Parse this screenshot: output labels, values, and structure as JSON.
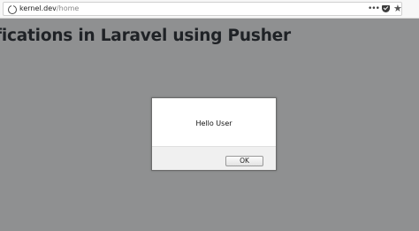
{
  "browser": {
    "url_domain": "kernel.dev",
    "url_path": "/home",
    "more_icon": "•••",
    "star_icon": "★"
  },
  "page": {
    "title": "fications in Laravel using Pusher"
  },
  "dialog": {
    "message": "Hello User",
    "ok_label": "OK"
  }
}
